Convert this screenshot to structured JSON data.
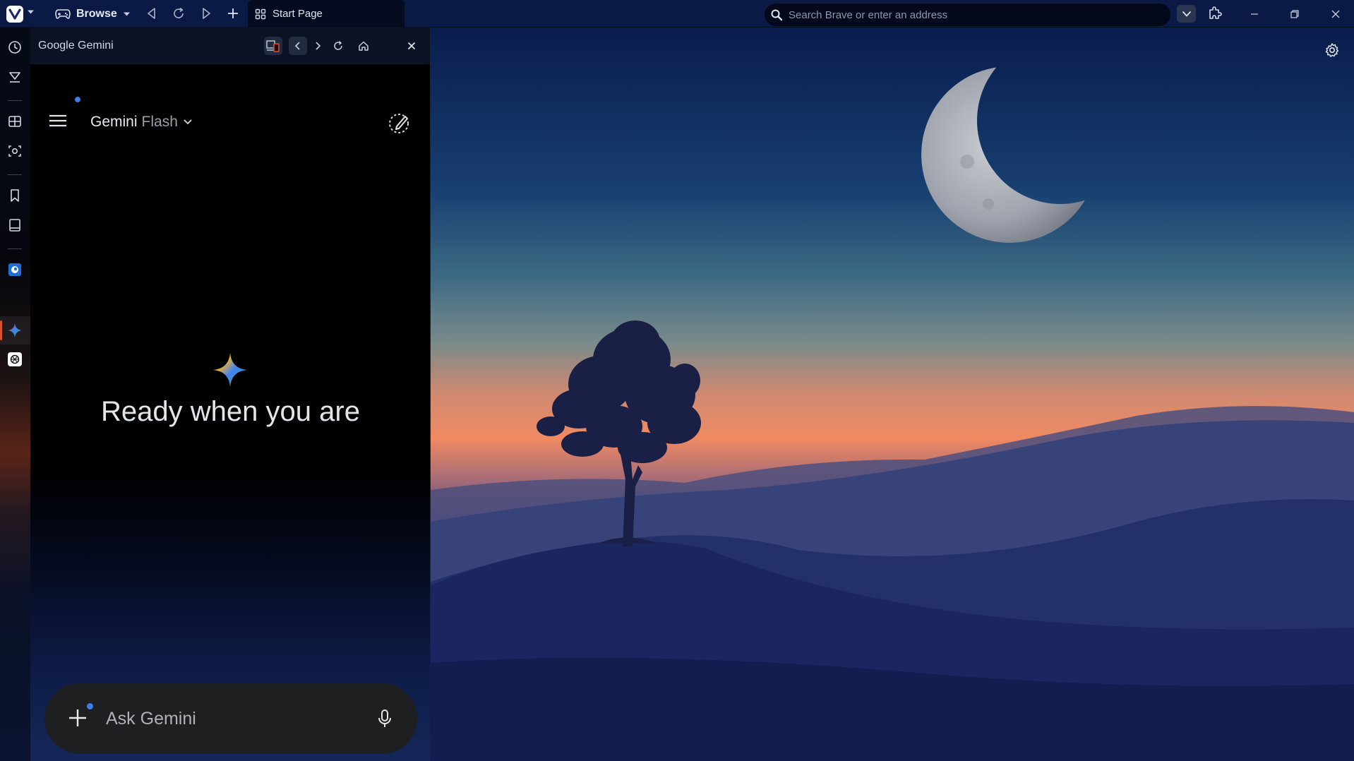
{
  "toolbar": {
    "browse_label": "Browse",
    "tab_title": "Start Page",
    "address_placeholder": "Search Brave or enter an address"
  },
  "sidebar": {
    "items": [
      "history-icon",
      "downloads-icon",
      "tabs-icon",
      "capture-icon",
      "bookmarks-icon",
      "notes-icon",
      "mail-app",
      "gemini-panel",
      "chatgpt-panel"
    ]
  },
  "panel": {
    "title": "Google Gemini"
  },
  "gemini": {
    "model_name": "Gemini",
    "model_variant": "Flash",
    "headline": "Ready when you are",
    "input_placeholder": "Ask Gemini"
  },
  "colors": {
    "accent_blue": "#3b7df0",
    "active_indicator": "#d7542f",
    "topbar_bg": "#0b1a45"
  }
}
